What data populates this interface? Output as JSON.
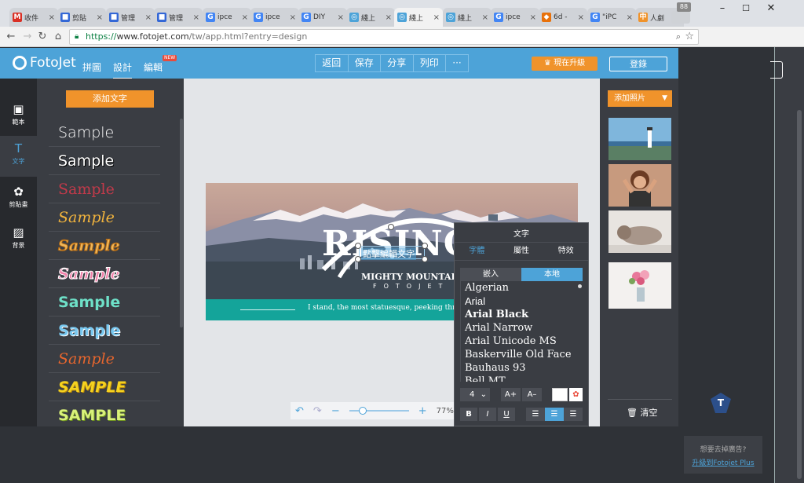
{
  "browser": {
    "tabs": [
      {
        "title": "收件",
        "favicon": "M",
        "color": "#d93025"
      },
      {
        "title": "剪貼",
        "favicon": "■",
        "color": "#3367d6"
      },
      {
        "title": "管理",
        "favicon": "■",
        "color": "#3367d6"
      },
      {
        "title": "管理",
        "favicon": "■",
        "color": "#3367d6"
      },
      {
        "title": "ipce",
        "favicon": "G",
        "color": "#4285f4"
      },
      {
        "title": "ipce",
        "favicon": "G",
        "color": "#4285f4"
      },
      {
        "title": "DIY",
        "favicon": "G",
        "color": "#4285f4"
      },
      {
        "title": "綫上",
        "favicon": "◎",
        "color": "#4da3d8"
      },
      {
        "title": "綫上",
        "favicon": "◎",
        "color": "#4da3d8"
      },
      {
        "title": "綫上",
        "favicon": "◎",
        "color": "#4da3d8"
      },
      {
        "title": "ipce",
        "favicon": "G",
        "color": "#4285f4"
      },
      {
        "title": "6d -",
        "favicon": "◆",
        "color": "#e8710a"
      },
      {
        "title": "\"iPC",
        "favicon": "G",
        "color": "#4285f4"
      },
      {
        "title": "人劇",
        "favicon": "中",
        "color": "#f0932b"
      }
    ],
    "tab_count": "88",
    "url_scheme": "https://",
    "url_host": "www.fotojet.com",
    "url_path": "/tw/app.html?entry=design",
    "window_controls": {
      "minimize": "–",
      "maximize": "☐",
      "close": "✕"
    }
  },
  "header": {
    "logo": "FotoJet",
    "nav": [
      "拼圖",
      "設計",
      "編輯"
    ],
    "new_badge": "NEW",
    "actions": [
      "返回",
      "保存",
      "分享",
      "列印",
      "···"
    ],
    "upgrade": "現在升級",
    "login": "登錄"
  },
  "rail": [
    {
      "label": "範本",
      "icon": "▣"
    },
    {
      "label": "文字",
      "icon": "T"
    },
    {
      "label": "剪貼畫",
      "icon": "✿"
    },
    {
      "label": "背景",
      "icon": "▨"
    }
  ],
  "text_panel": {
    "add_button": "添加文字",
    "samples": [
      {
        "text": "Sample",
        "color": "#ffffff"
      },
      {
        "text": "Sample",
        "color": "#ffffff"
      },
      {
        "text": "Sample",
        "color": "#c23a4a"
      },
      {
        "text": "Sample",
        "color": "#f2b43d"
      },
      {
        "text": "Sample",
        "color": "#f0b75a"
      },
      {
        "text": "Sample",
        "color": "#f07fa8"
      },
      {
        "text": "Sample",
        "color": "#6ee0c8"
      },
      {
        "text": "Sample",
        "color": "#78c8f0"
      },
      {
        "text": "Sample",
        "color": "#e8662e"
      },
      {
        "text": "SAMPLE",
        "color": "#f5d21f"
      },
      {
        "text": "SAMPLE",
        "color": "#d9f27a"
      }
    ]
  },
  "canvas": {
    "headline": "RISING",
    "edit_text": "點擊編輯文字",
    "subtitle": "MIGHTY MOUNTAIN",
    "brand": "FOTOJET",
    "caption": "I stand, the most statuesque, peeking through the c",
    "zoom": "77%"
  },
  "font_popup": {
    "title": "文字",
    "tabs": [
      "字體",
      "屬性",
      "特效"
    ],
    "source_tabs": [
      "嵌入",
      "本地"
    ],
    "fonts": [
      "Algerian",
      "Arial",
      "Arial Black",
      "Arial Narrow",
      "Arial Unicode MS",
      "Baskerville Old Face",
      "Bauhaus 93",
      "Bell MT"
    ],
    "size": "4",
    "size_up": "A+",
    "size_down": "A–",
    "bold": "B",
    "italic": "I",
    "underline": "U"
  },
  "photos_panel": {
    "add_button": "添加照片",
    "clear": "清空",
    "photos": [
      "lighthouse-photo",
      "woman-photo",
      "cat-photo",
      "flowers-photo"
    ]
  },
  "ad": {
    "question": "想要去掉廣告?",
    "link": "升級到Fotojet Plus"
  },
  "colors": {
    "brand_blue": "#4da3d8",
    "orange": "#f0932b",
    "panel": "#3a3d43",
    "teal": "#14a49a"
  }
}
